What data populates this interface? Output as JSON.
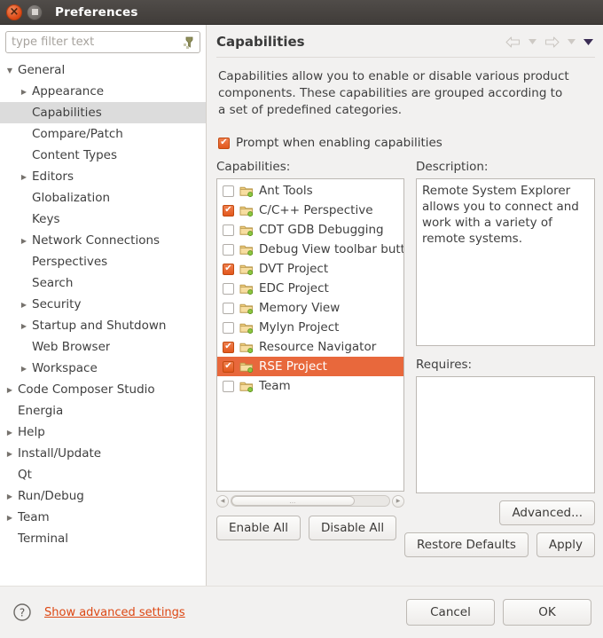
{
  "window": {
    "title": "Preferences",
    "close_icon": "close-icon",
    "maximize_icon": "maximize-icon"
  },
  "sidebar": {
    "filter": {
      "value": "",
      "placeholder": "type filter text",
      "icon": "filter-clear-icon"
    },
    "items": [
      {
        "label": "General",
        "level": 0,
        "twisty": "expanded",
        "selected": false
      },
      {
        "label": "Appearance",
        "level": 1,
        "twisty": "collapsed",
        "selected": false
      },
      {
        "label": "Capabilities",
        "level": 1,
        "twisty": "none",
        "selected": true
      },
      {
        "label": "Compare/Patch",
        "level": 1,
        "twisty": "none",
        "selected": false
      },
      {
        "label": "Content Types",
        "level": 1,
        "twisty": "none",
        "selected": false
      },
      {
        "label": "Editors",
        "level": 1,
        "twisty": "collapsed",
        "selected": false
      },
      {
        "label": "Globalization",
        "level": 1,
        "twisty": "none",
        "selected": false
      },
      {
        "label": "Keys",
        "level": 1,
        "twisty": "none",
        "selected": false
      },
      {
        "label": "Network Connections",
        "level": 1,
        "twisty": "collapsed",
        "selected": false
      },
      {
        "label": "Perspectives",
        "level": 1,
        "twisty": "none",
        "selected": false
      },
      {
        "label": "Search",
        "level": 1,
        "twisty": "none",
        "selected": false
      },
      {
        "label": "Security",
        "level": 1,
        "twisty": "collapsed",
        "selected": false
      },
      {
        "label": "Startup and Shutdown",
        "level": 1,
        "twisty": "collapsed",
        "selected": false
      },
      {
        "label": "Web Browser",
        "level": 1,
        "twisty": "none",
        "selected": false
      },
      {
        "label": "Workspace",
        "level": 1,
        "twisty": "collapsed",
        "selected": false
      },
      {
        "label": "Code Composer Studio",
        "level": 0,
        "twisty": "collapsed",
        "selected": false
      },
      {
        "label": "Energia",
        "level": 0,
        "twisty": "none",
        "selected": false
      },
      {
        "label": "Help",
        "level": 0,
        "twisty": "collapsed",
        "selected": false
      },
      {
        "label": "Install/Update",
        "level": 0,
        "twisty": "collapsed",
        "selected": false
      },
      {
        "label": "Qt",
        "level": 0,
        "twisty": "none",
        "selected": false
      },
      {
        "label": "Run/Debug",
        "level": 0,
        "twisty": "collapsed",
        "selected": false
      },
      {
        "label": "Team",
        "level": 0,
        "twisty": "collapsed",
        "selected": false
      },
      {
        "label": "Terminal",
        "level": 0,
        "twisty": "none",
        "selected": false
      }
    ]
  },
  "page": {
    "title": "Capabilities",
    "description": "Capabilities allow you to enable or disable various product components. These capabilities are grouped according to a set of predefined categories.",
    "nav": {
      "back_icon": "back-arrow-icon",
      "back_menu_icon": "chevron-down-icon",
      "forward_icon": "forward-arrow-icon",
      "forward_menu_icon": "chevron-down-icon",
      "menu_icon": "chevron-down-filled-icon"
    },
    "prompt_checkbox": {
      "label": "Prompt when enabling capabilities",
      "checked": true
    },
    "capabilities_label": "Capabilities:",
    "capabilities": [
      {
        "label": "Ant Tools",
        "checked": false,
        "selected": false
      },
      {
        "label": "C/C++ Perspective",
        "checked": true,
        "selected": false
      },
      {
        "label": "CDT GDB Debugging",
        "checked": false,
        "selected": false
      },
      {
        "label": "Debug View toolbar butt",
        "checked": false,
        "selected": false
      },
      {
        "label": "DVT Project",
        "checked": true,
        "selected": false
      },
      {
        "label": "EDC Project",
        "checked": false,
        "selected": false
      },
      {
        "label": "Memory View",
        "checked": false,
        "selected": false
      },
      {
        "label": "Mylyn Project",
        "checked": false,
        "selected": false
      },
      {
        "label": "Resource Navigator",
        "checked": true,
        "selected": false
      },
      {
        "label": "RSE Project",
        "checked": true,
        "selected": true
      },
      {
        "label": "Team",
        "checked": false,
        "selected": false
      }
    ],
    "description_label": "Description:",
    "description_text": "Remote System Explorer allows you to connect and work with a variety of remote systems.",
    "requires_label": "Requires:",
    "requires_text": "",
    "buttons": {
      "enable_all": "Enable All",
      "disable_all": "Disable All",
      "advanced": "Advanced...",
      "restore_defaults": "Restore Defaults",
      "apply": "Apply"
    }
  },
  "footer": {
    "help_icon": "help-icon",
    "advanced_link": "Show advanced settings",
    "cancel": "Cancel",
    "ok": "OK"
  },
  "colors": {
    "accent": "#dd4814",
    "selection": "#e8683c",
    "titlebar": "#403c39",
    "panel_bg": "#f2f1f0"
  }
}
